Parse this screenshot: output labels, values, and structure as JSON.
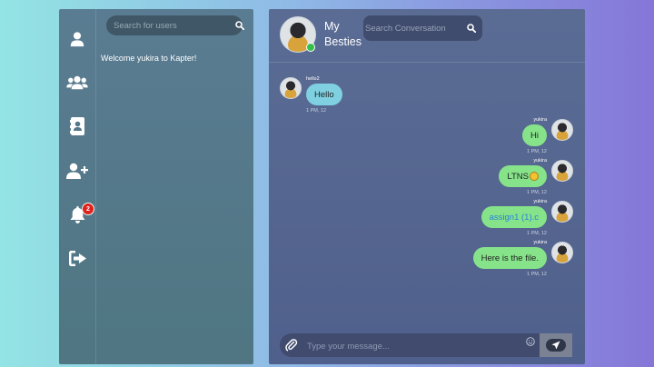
{
  "sidebar": {
    "nav": [
      {
        "icon": "user-icon"
      },
      {
        "icon": "users-group-icon"
      },
      {
        "icon": "contacts-book-icon"
      },
      {
        "icon": "add-user-icon"
      },
      {
        "icon": "bell-icon",
        "badge": "2"
      },
      {
        "icon": "sign-out-icon"
      }
    ],
    "search_placeholder": "Search for users",
    "welcome": "Welcome yukira to Kapter!"
  },
  "chat": {
    "name": "My Besties",
    "search_placeholder": "Search Conversation",
    "messages": [
      {
        "sender": "hello2",
        "text": "Hello",
        "time": "1 PM, 12",
        "direction": "in"
      },
      {
        "sender": "yukira",
        "text": "Hi",
        "time": "1 PM, 12",
        "direction": "out"
      },
      {
        "sender": "yukira",
        "text": "LTNS",
        "emoji": "smiling-face-emoji",
        "time": "1 PM, 12",
        "direction": "out"
      },
      {
        "sender": "yukira",
        "text": "assign1 (1).c",
        "time": "1 PM, 12",
        "direction": "out",
        "type": "file-link"
      },
      {
        "sender": "yukira",
        "text": "Here is the file.",
        "time": "1 PM, 12",
        "direction": "out"
      }
    ],
    "composer": {
      "placeholder": "Type your message...",
      "attach_icon": "paperclip-icon",
      "emoji_icon": "smiley-icon",
      "send_icon": "send-arrow-icon"
    }
  },
  "colors": {
    "incoming_bubble": "#7fd0e0",
    "outgoing_bubble": "#86e38a",
    "badge": "#e0211b",
    "online": "#33c04b",
    "link": "#2a7fe0"
  }
}
